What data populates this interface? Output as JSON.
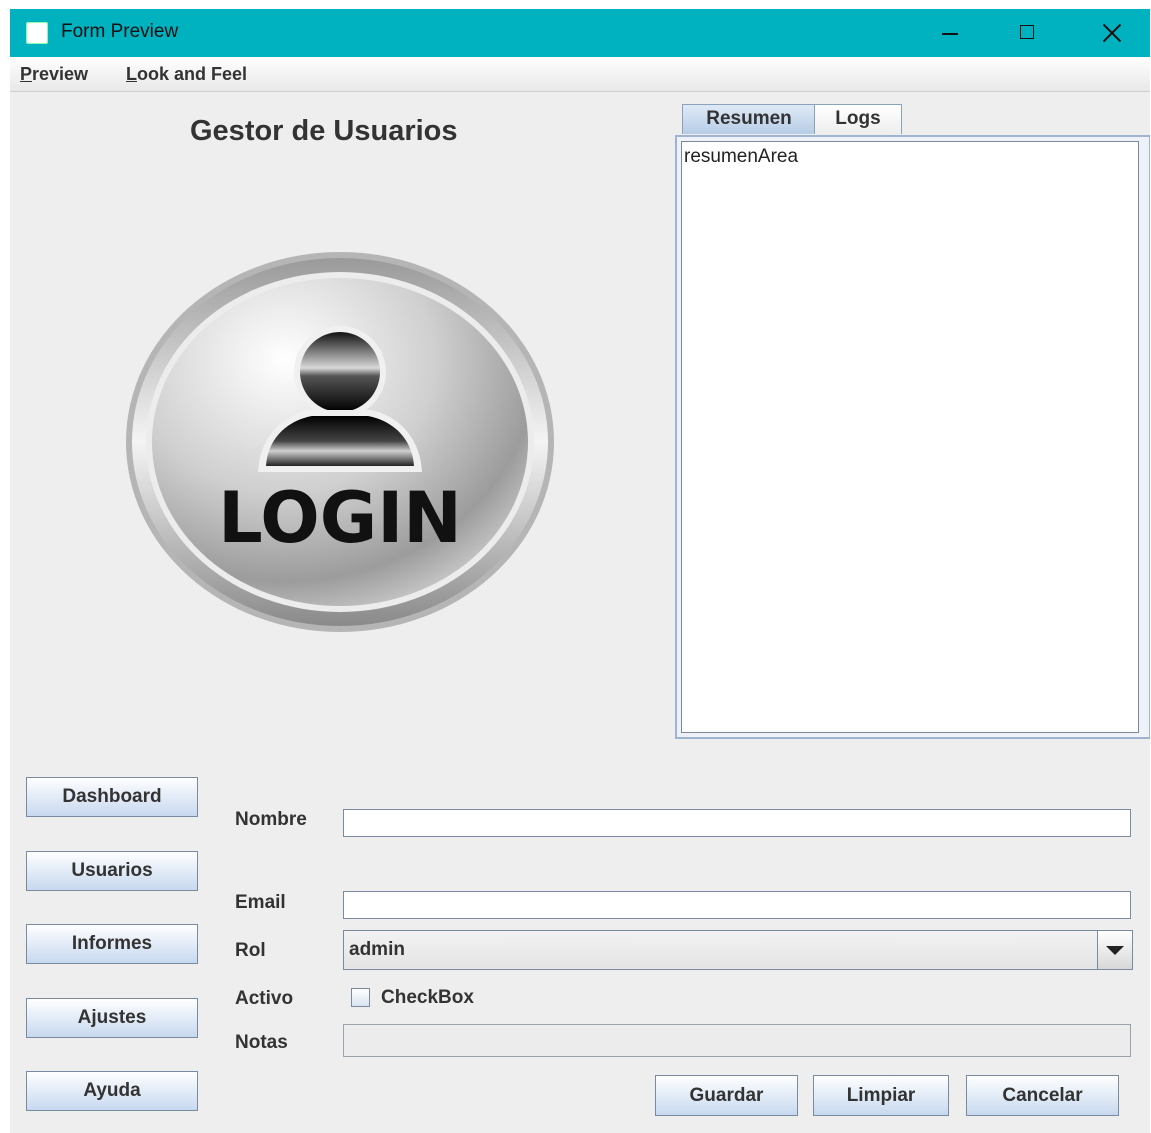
{
  "window": {
    "title": "Form Preview"
  },
  "menubar": {
    "items": [
      {
        "mnemonic": "P",
        "rest": "review"
      },
      {
        "mnemonic": "L",
        "rest": "ook and Feel"
      }
    ]
  },
  "heading": "Gestor de Usuarios",
  "logo": {
    "text": "LOGIN",
    "icon": "user-login-icon"
  },
  "tabs": {
    "items": [
      {
        "label": "Resumen",
        "selected": true
      },
      {
        "label": "Logs",
        "selected": false
      }
    ],
    "resumen_text": "resumenArea"
  },
  "sidebar": {
    "buttons": [
      {
        "label": "Dashboard"
      },
      {
        "label": "Usuarios"
      },
      {
        "label": "Informes"
      },
      {
        "label": "Ajustes"
      },
      {
        "label": "Ayuda"
      }
    ]
  },
  "form": {
    "nombre_label": "Nombre",
    "nombre_value": "",
    "email_label": "Email",
    "email_value": "",
    "rol_label": "Rol",
    "rol_value": "admin",
    "activo_label": "Activo",
    "checkbox_label": "CheckBox",
    "checkbox_checked": false,
    "notas_label": "Notas",
    "notas_value": ""
  },
  "actions": {
    "guardar": "Guardar",
    "limpiar": "Limpiar",
    "cancelar": "Cancelar"
  },
  "colors": {
    "titlebar": "#00b1c0",
    "button_top": "#ffffff",
    "button_bottom": "#c7d9ef",
    "background": "#eeeeee"
  }
}
